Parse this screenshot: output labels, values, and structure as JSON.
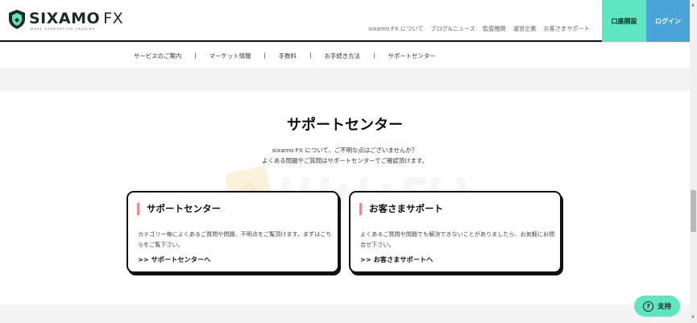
{
  "header": {
    "logo_text": "SIXAMO",
    "logo_fx": "FX",
    "logo_tagline": "MAKE GENERATION TRADING",
    "nav": [
      "sixamo FX について",
      "ブログ&ニュース",
      "監査機関",
      "運営企業",
      "お客さまサポート"
    ],
    "open_account_label": "口座開設",
    "login_label": "ログイン",
    "colors": {
      "open_account": "#5ee6c0",
      "login": "#49a4da"
    }
  },
  "subnav": {
    "items": [
      "サービスのご案内",
      "マーケット情報",
      "手数料",
      "お手続き方法",
      "サポートセンター"
    ]
  },
  "main": {
    "title": "サポートセンター",
    "description_line1": "sixamo FX について、ご不明な点はございませんか？",
    "description_line2": "よくある問題やご質問はサポートセンターでご確認頂けます。",
    "cards": [
      {
        "heading": "サポートセンター",
        "body": "カテゴリー毎によくあるご質問や問題、不明点をご覧頂けます。まずはこちらをご覧下さい。",
        "link": ">> サポートセンターへ"
      },
      {
        "heading": "お客さまサポート",
        "body": "よくあるご質問や問題でも解決できないことがありましたら、お気軽にお問合せ下さい。",
        "link": ">> お客さまサポートへ"
      }
    ],
    "accent_color": "#f08a8a"
  },
  "float_support": {
    "label": "支持",
    "icon": "question-icon"
  }
}
